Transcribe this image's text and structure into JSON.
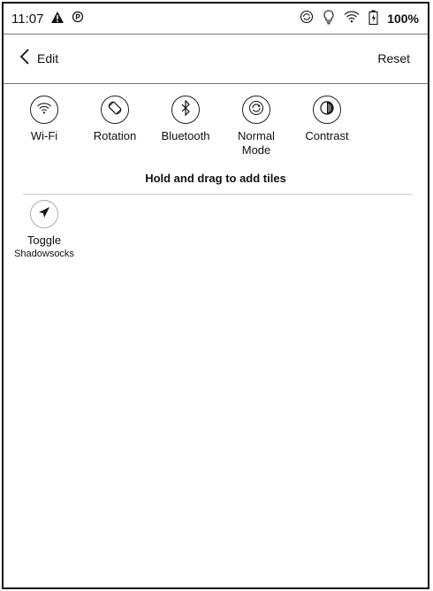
{
  "status_bar": {
    "time": "11:07",
    "battery_percent": "100%",
    "icons": [
      "warning-icon",
      "pinned-app-icon",
      "sync-icon",
      "light-icon",
      "wifi-icon",
      "battery-icon"
    ]
  },
  "header": {
    "title": "Edit",
    "reset_label": "Reset"
  },
  "tiles": [
    {
      "label": "Wi-Fi",
      "icon": "wifi-icon"
    },
    {
      "label": "Rotation",
      "icon": "rotation-icon"
    },
    {
      "label": "Bluetooth",
      "icon": "bluetooth-icon"
    },
    {
      "label": "Normal\nMode",
      "icon": "refresh-mode-icon"
    },
    {
      "label": "Contrast",
      "icon": "contrast-icon"
    }
  ],
  "hint": "Hold and drag to add tiles",
  "available_tiles": [
    {
      "label": "Toggle",
      "sublabel": "Shadowsocks",
      "icon": "paper-plane-icon"
    }
  ]
}
